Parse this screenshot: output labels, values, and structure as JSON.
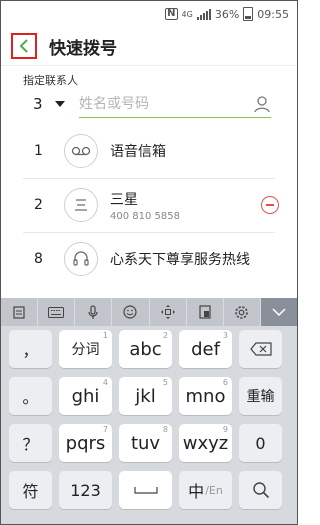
{
  "status_bar": {
    "network": "4G",
    "battery": "36%",
    "time": "09:55",
    "nfc": "N"
  },
  "header": {
    "title": "快速拨号"
  },
  "assign": {
    "label": "指定联系人",
    "number": "3",
    "search_placeholder": "姓名或号码"
  },
  "speed_dial": [
    {
      "index": "1",
      "name": "语音信箱",
      "number": "",
      "icon": "voicemail-icon"
    },
    {
      "index": "2",
      "name": "三星",
      "number": "400 810 5858",
      "icon": "contact-icon"
    },
    {
      "index": "8",
      "name": "心系天下尊享服务热线",
      "number": "",
      "icon": "headset-icon"
    }
  ],
  "keyboard": {
    "toolbar": [
      "clipboard-icon",
      "keyboard-icon",
      "mic-icon",
      "emoji-icon",
      "cursor-move-icon",
      "one-hand-icon",
      "settings-icon",
      "collapse-icon"
    ],
    "rows": [
      {
        "side_left": "，",
        "keys": [
          {
            "label": "分词",
            "hint": "1"
          },
          {
            "label": "abc",
            "hint": "2"
          },
          {
            "label": "def",
            "hint": "3"
          }
        ],
        "side_right": "backspace-icon"
      },
      {
        "side_left": "。",
        "keys": [
          {
            "label": "ghi",
            "hint": "4"
          },
          {
            "label": "jkl",
            "hint": "5"
          },
          {
            "label": "mno",
            "hint": "6"
          }
        ],
        "side_right": "重输"
      },
      {
        "side_left": "？",
        "keys": [
          {
            "label": "pqrs",
            "hint": "7"
          },
          {
            "label": "tuv",
            "hint": "8"
          },
          {
            "label": "wxyz",
            "hint": "9"
          }
        ],
        "side_right": "0"
      },
      {
        "side_left": "符",
        "keys": [
          {
            "label": "123",
            "hint": ""
          },
          {
            "label": "",
            "hint": ""
          },
          {
            "label": "中",
            "hint": ""
          }
        ],
        "side_right": "search-icon"
      }
    ],
    "lang_suffix": "/En"
  }
}
